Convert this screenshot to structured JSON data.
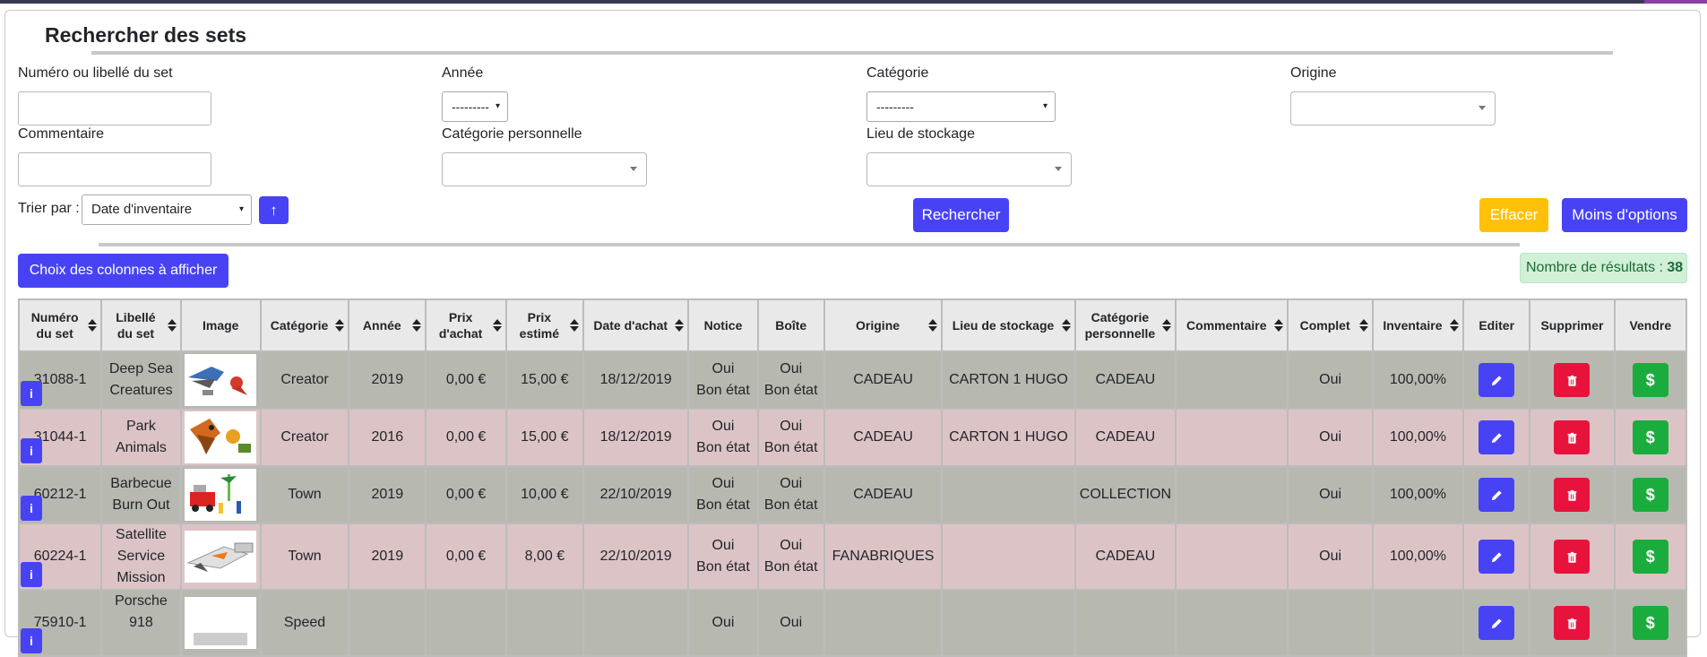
{
  "page": {
    "title": "Rechercher des sets"
  },
  "filters": {
    "set_label": "Numéro ou libellé du set",
    "set_value": "",
    "year_label": "Année",
    "year_selected": "---------",
    "category_label": "Catégorie",
    "category_selected": "---------",
    "origin_label": "Origine",
    "comment_label": "Commentaire",
    "comment_value": "",
    "personal_category_label": "Catégorie personnelle",
    "storage_label": "Lieu de stockage",
    "sort_label": "Trier par :",
    "sort_selected": "Date d'inventaire",
    "sort_dir_icon": "↑"
  },
  "buttons": {
    "search": "Rechercher",
    "clear": "Effacer",
    "less_options": "Moins d'options",
    "choose_columns": "Choix des colonnes à afficher"
  },
  "results": {
    "label": "Nombre de résultats :",
    "count": "38"
  },
  "colors": {
    "primary": "#4743f5",
    "warning": "#ffc107",
    "danger": "#e8133c",
    "success": "#1aad3d",
    "row_gray": "#b7b9b1",
    "row_pink": "#dcc4c6"
  },
  "table": {
    "headers": [
      {
        "l1": "Numéro",
        "l2": "du set"
      },
      {
        "l1": "Libellé",
        "l2": "du set"
      },
      {
        "l1": "Image",
        "l2": ""
      },
      {
        "l1": "Catégorie",
        "l2": ""
      },
      {
        "l1": "Année",
        "l2": ""
      },
      {
        "l1": "Prix",
        "l2": "d'achat"
      },
      {
        "l1": "Prix",
        "l2": "estimé"
      },
      {
        "l1": "Date d'achat",
        "l2": ""
      },
      {
        "l1": "Notice",
        "l2": ""
      },
      {
        "l1": "Boîte",
        "l2": ""
      },
      {
        "l1": "Origine",
        "l2": ""
      },
      {
        "l1": "Lieu de stockage",
        "l2": ""
      },
      {
        "l1": "Catégorie",
        "l2": "personnelle"
      },
      {
        "l1": "Commentaire",
        "l2": ""
      },
      {
        "l1": "Complet",
        "l2": ""
      },
      {
        "l1": "Inventaire",
        "l2": ""
      },
      {
        "l1": "Editer",
        "l2": ""
      },
      {
        "l1": "Supprimer",
        "l2": ""
      },
      {
        "l1": "Vendre",
        "l2": ""
      }
    ],
    "rows": [
      {
        "num": "31088-1",
        "name": [
          "Deep Sea",
          "Creatures"
        ],
        "category": "Creator",
        "year": "2019",
        "purchase": "0,00 €",
        "estimated": "15,00 €",
        "date": "18/12/2019",
        "notice": [
          "Oui",
          "Bon état"
        ],
        "box": [
          "Oui",
          "Bon état"
        ],
        "origin": "CADEAU",
        "storage": "CARTON 1 HUGO",
        "personal": "CADEAU",
        "comment": "",
        "complete": "Oui",
        "inventory": "100,00%"
      },
      {
        "num": "31044-1",
        "name": [
          "Park",
          "Animals"
        ],
        "category": "Creator",
        "year": "2016",
        "purchase": "0,00 €",
        "estimated": "15,00 €",
        "date": "18/12/2019",
        "notice": [
          "Oui",
          "Bon état"
        ],
        "box": [
          "Oui",
          "Bon état"
        ],
        "origin": "CADEAU",
        "storage": "CARTON 1 HUGO",
        "personal": "CADEAU",
        "comment": "",
        "complete": "Oui",
        "inventory": "100,00%"
      },
      {
        "num": "60212-1",
        "name": [
          "Barbecue",
          "Burn Out"
        ],
        "category": "Town",
        "year": "2019",
        "purchase": "0,00 €",
        "estimated": "10,00 €",
        "date": "22/10/2019",
        "notice": [
          "Oui",
          "Bon état"
        ],
        "box": [
          "Oui",
          "Bon état"
        ],
        "origin": "CADEAU",
        "storage": "",
        "personal": "COLLECTION",
        "comment": "",
        "complete": "Oui",
        "inventory": "100,00%"
      },
      {
        "num": "60224-1",
        "name": [
          "Satellite",
          "Service",
          "Mission"
        ],
        "category": "Town",
        "year": "2019",
        "purchase": "0,00 €",
        "estimated": "8,00 €",
        "date": "22/10/2019",
        "notice": [
          "Oui",
          "Bon état"
        ],
        "box": [
          "Oui",
          "Bon état"
        ],
        "origin": "FANABRIQUES",
        "storage": "",
        "personal": "CADEAU",
        "comment": "",
        "complete": "Oui",
        "inventory": "100,00%"
      },
      {
        "num": "75910-1",
        "name": [
          "Porsche 918",
          "",
          ""
        ],
        "category": "Speed",
        "year": "",
        "purchase": "",
        "estimated": "",
        "date": "",
        "notice": [
          "Oui",
          ""
        ],
        "box": [
          "Oui",
          ""
        ],
        "origin": "",
        "storage": "",
        "personal": "",
        "comment": "",
        "complete": "",
        "inventory": ""
      }
    ],
    "icons": {
      "info": "info-icon",
      "edit": "pencil-icon",
      "delete": "trash-icon",
      "sell": "dollar-icon"
    }
  }
}
